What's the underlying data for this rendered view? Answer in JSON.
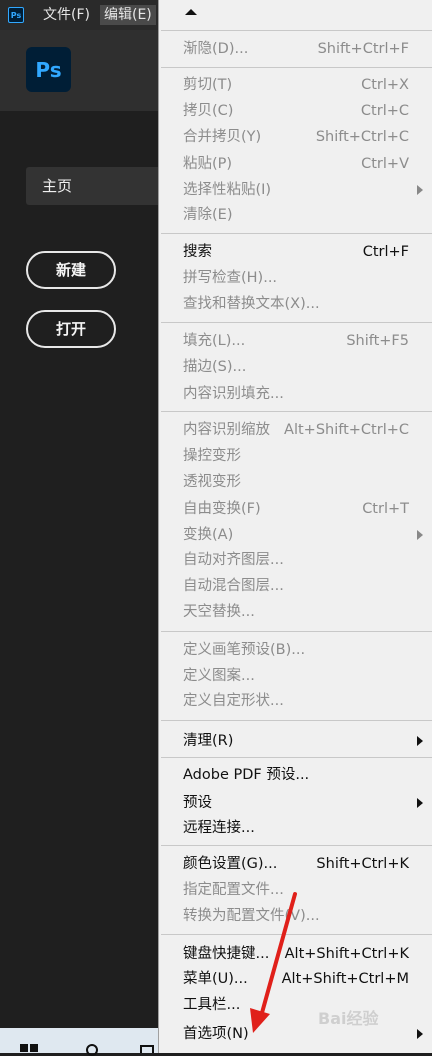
{
  "menubar": {
    "app_icon_text": "Ps",
    "file_label": "文件(F)",
    "edit_label": "编辑(E)"
  },
  "home": {
    "logo_text": "Ps",
    "nav_home_label": "主页",
    "new_button": "新建",
    "open_button": "打开"
  },
  "menu": {
    "fade": {
      "label": "渐隐(D)...",
      "shortcut": "Shift+Ctrl+F"
    },
    "cut": {
      "label": "剪切(T)",
      "shortcut": "Ctrl+X"
    },
    "copy": {
      "label": "拷贝(C)",
      "shortcut": "Ctrl+C"
    },
    "copy_merged": {
      "label": "合并拷贝(Y)",
      "shortcut": "Shift+Ctrl+C"
    },
    "paste": {
      "label": "粘贴(P)",
      "shortcut": "Ctrl+V"
    },
    "paste_special": {
      "label": "选择性粘贴(I)"
    },
    "clear": {
      "label": "清除(E)"
    },
    "search": {
      "label": "搜索",
      "shortcut": "Ctrl+F"
    },
    "spell_check": {
      "label": "拼写检查(H)..."
    },
    "find_replace": {
      "label": "查找和替换文本(X)..."
    },
    "fill": {
      "label": "填充(L)...",
      "shortcut": "Shift+F5"
    },
    "stroke": {
      "label": "描边(S)..."
    },
    "content_aware_fill": {
      "label": "内容识别填充..."
    },
    "content_aware_scale": {
      "label": "内容识别缩放",
      "shortcut": "Alt+Shift+Ctrl+C"
    },
    "puppet_warp": {
      "label": "操控变形"
    },
    "perspective_warp": {
      "label": "透视变形"
    },
    "free_transform": {
      "label": "自由变换(F)",
      "shortcut": "Ctrl+T"
    },
    "transform": {
      "label": "变换(A)"
    },
    "auto_align": {
      "label": "自动对齐图层..."
    },
    "auto_blend": {
      "label": "自动混合图层..."
    },
    "sky_replace": {
      "label": "天空替换..."
    },
    "define_brush": {
      "label": "定义画笔预设(B)..."
    },
    "define_pattern": {
      "label": "定义图案..."
    },
    "define_shape": {
      "label": "定义自定形状..."
    },
    "purge": {
      "label": "清理(R)"
    },
    "pdf_presets": {
      "label": "Adobe PDF 预设..."
    },
    "presets": {
      "label": "预设"
    },
    "remote": {
      "label": "远程连接..."
    },
    "color_settings": {
      "label": "颜色设置(G)...",
      "shortcut": "Shift+Ctrl+K"
    },
    "assign_profile": {
      "label": "指定配置文件..."
    },
    "convert_profile": {
      "label": "转换为配置文件(V)..."
    },
    "keyboard_shortcuts": {
      "label": "键盘快捷键...",
      "shortcut": "Alt+Shift+Ctrl+K"
    },
    "menus": {
      "label": "菜单(U)...",
      "shortcut": "Alt+Shift+Ctrl+M"
    },
    "toolbar": {
      "label": "工具栏..."
    },
    "preferences": {
      "label": "首选项(N)"
    }
  },
  "watermark": "Bai经验"
}
